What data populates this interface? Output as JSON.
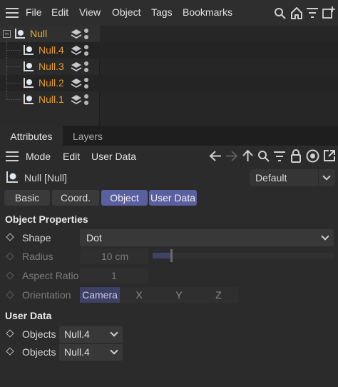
{
  "object_manager": {
    "menu": [
      "File",
      "Edit",
      "View",
      "Object",
      "Tags",
      "Bookmarks"
    ],
    "objects": [
      {
        "label": "Null",
        "level": 0
      },
      {
        "label": "Null.4",
        "level": 1
      },
      {
        "label": "Null.3",
        "level": 1
      },
      {
        "label": "Null.2",
        "level": 1
      },
      {
        "label": "Null.1",
        "level": 1
      }
    ]
  },
  "panel_tabs": [
    "Attributes",
    "Layers"
  ],
  "attributes": {
    "menu": [
      "Mode",
      "Edit",
      "User Data"
    ],
    "object_title": "Null [Null]",
    "preset": "Default",
    "tabs": [
      "Basic",
      "Coord.",
      "Object",
      "User Data"
    ],
    "active_tab": "Object",
    "object_properties": {
      "title": "Object Properties",
      "shape_label": "Shape",
      "shape_value": "Dot",
      "radius_label": "Radius",
      "radius_value": "10 cm",
      "radius_slider_fraction": 0.1,
      "aspect_label": "Aspect Ratio",
      "aspect_value": "1",
      "orientation_label": "Orientation",
      "orientation_options": [
        "Camera",
        "X",
        "Y",
        "Z"
      ],
      "orientation_selected": "Camera"
    },
    "user_data": {
      "title": "User Data",
      "items": [
        {
          "label": "Objects",
          "value": "Null.4"
        },
        {
          "label": "Objects",
          "value": "Null.4"
        }
      ]
    }
  },
  "colors": {
    "accent": "#5a5fa0",
    "object_label": "#e59a2e",
    "background": "#2b2b2b"
  },
  "icons": [
    "hamburger-icon",
    "search-icon",
    "home-icon",
    "filter-icon",
    "add-panel-icon",
    "expand-icon",
    "null-object-icon",
    "layer-icon",
    "visibility-dots-icon",
    "back-arrow-icon",
    "forward-arrow-icon",
    "up-arrow-icon",
    "lock-icon",
    "target-icon",
    "new-window-icon"
  ]
}
